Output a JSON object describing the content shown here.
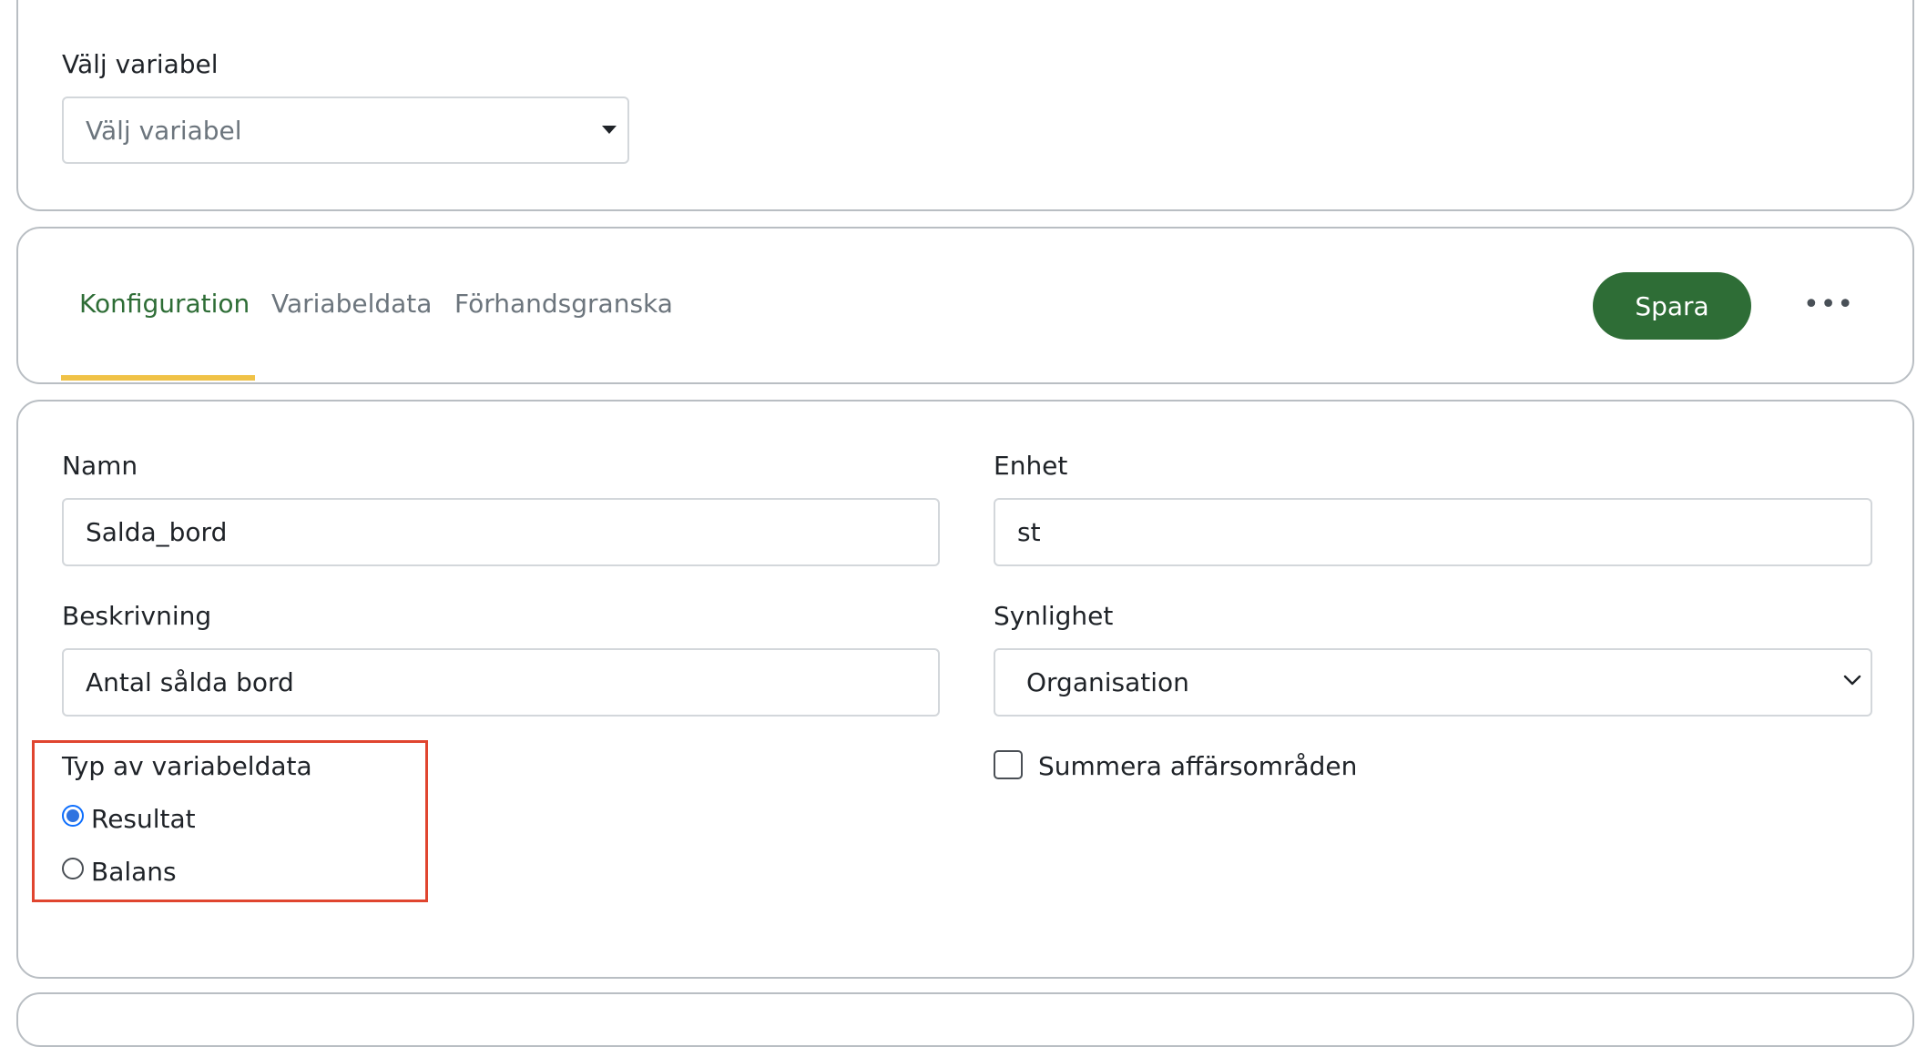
{
  "variable_select": {
    "label": "Välj variabel",
    "placeholder": "Välj variabel"
  },
  "tabs": [
    {
      "label": "Konfiguration",
      "active": true
    },
    {
      "label": "Variabeldata",
      "active": false
    },
    {
      "label": "Förhandsgranska",
      "active": false
    }
  ],
  "toolbar": {
    "save_label": "Spara",
    "more_label": "•••"
  },
  "form": {
    "name": {
      "label": "Namn",
      "value": "Salda_bord"
    },
    "unit": {
      "label": "Enhet",
      "value": "st"
    },
    "description": {
      "label": "Beskrivning",
      "value": "Antal sålda bord"
    },
    "visibility": {
      "label": "Synlighet",
      "value": "Organisation"
    },
    "data_type": {
      "label": "Typ av variabeldata",
      "options": [
        {
          "label": "Resultat",
          "checked": true
        },
        {
          "label": "Balans",
          "checked": false
        }
      ]
    },
    "sum_business_areas": {
      "label": "Summera affärsområden",
      "checked": false
    }
  },
  "colors": {
    "accent_green": "#2e6d36",
    "tab_underline": "#f0c247",
    "highlight": "#e0452f"
  }
}
